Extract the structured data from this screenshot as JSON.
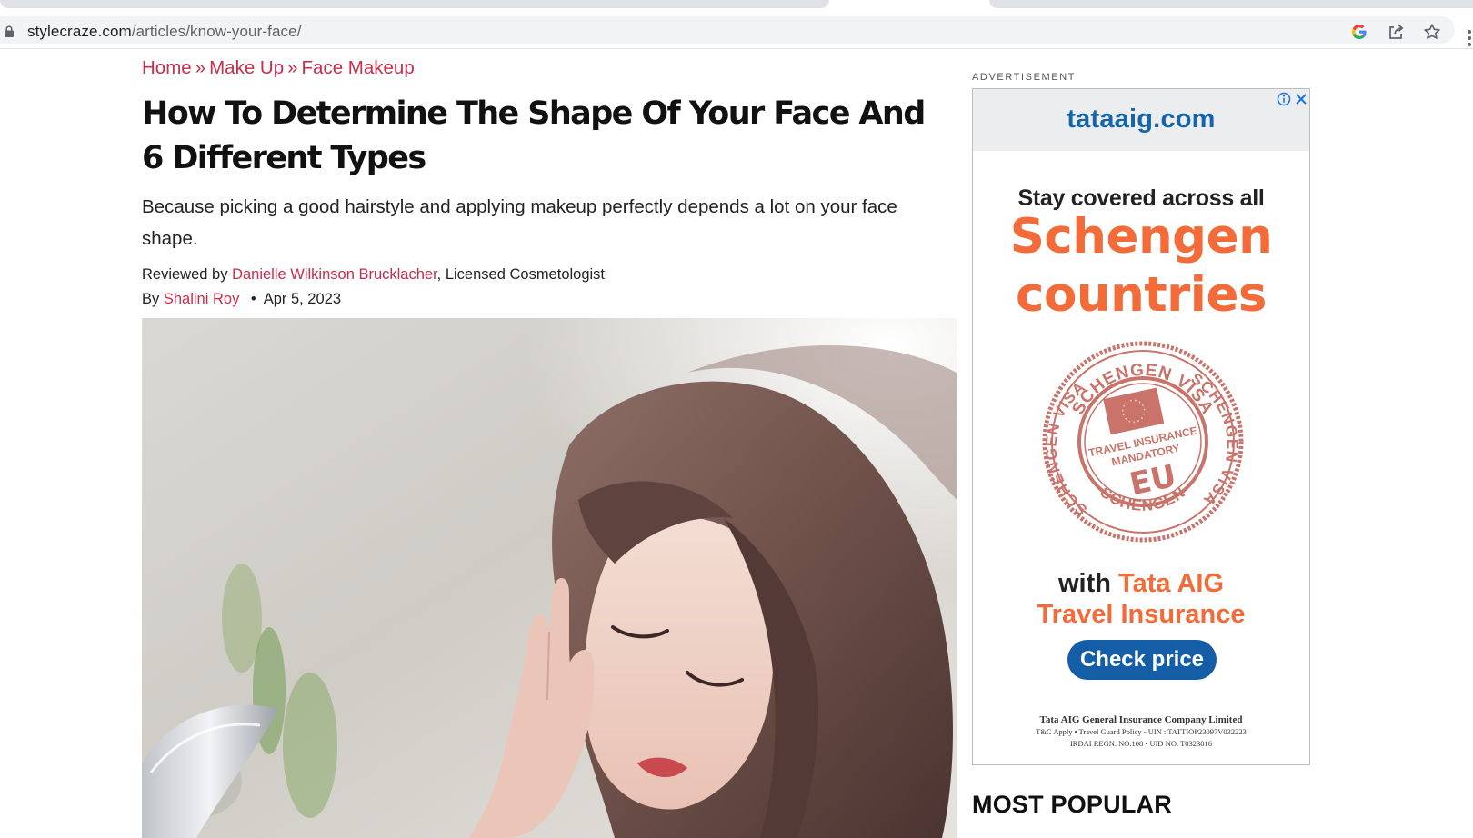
{
  "browser": {
    "url_host": "stylecraze.com",
    "url_path": "/articles/know-your-face/",
    "icons": [
      "lock-icon",
      "google-icon",
      "share-icon",
      "star-icon",
      "kebab-menu-icon"
    ]
  },
  "article": {
    "breadcrumb": [
      {
        "label": "Home"
      },
      {
        "label": "Make Up"
      },
      {
        "label": "Face Makeup"
      }
    ],
    "breadcrumb_separator": "»",
    "title": "How To Determine The Shape Of Your Face And 6 Different Types",
    "subtitle": "Because picking a good hairstyle and applying makeup perfectly depends a lot on your face shape.",
    "reviewed_prefix": "Reviewed by",
    "reviewer_name": "Danielle Wilkinson Brucklacher",
    "reviewer_suffix": ", Licensed Cosmetologist",
    "author_prefix": "By",
    "author_name": "Shalini Roy",
    "date_separator": "•",
    "date": "Apr 5, 2023",
    "hero_image": "woman-touching-face-with-mirror"
  },
  "sidebar": {
    "ad_label": "ADVERTISEMENT",
    "ad": {
      "domain": "tataaig.com",
      "headline": "Stay covered across all",
      "highlight_line1": "Schengen",
      "highlight_line2": "countries",
      "stamp": {
        "top_text": "SCHENGEN VISA",
        "right_text": "SCHENGEN VISA",
        "bottom_text": "SCHENGEN",
        "left_text": "SCHENGEN VISA",
        "center_line1": "TRAVEL INSURANCE",
        "center_line2": "MANDATORY",
        "center_big": "EU"
      },
      "with_text": "with",
      "brand": "Tata AIG",
      "product": "Travel Insurance",
      "cta": "Check price",
      "legal_company": "Tata AIG General Insurance Company Limited",
      "legal_line2": "T&C Apply  •  Travel Guard Policy - UIN : TATTIOP23097V032223",
      "legal_line3": "IRDAI REGN. NO.108  •  UID NO. T0323016",
      "colors": {
        "orange": "#f26b38",
        "blue": "#145ea8",
        "stamp": "#c9736a"
      }
    },
    "most_popular": "MOST POPULAR"
  },
  "colors": {
    "accent_link": "#c82d4a"
  }
}
